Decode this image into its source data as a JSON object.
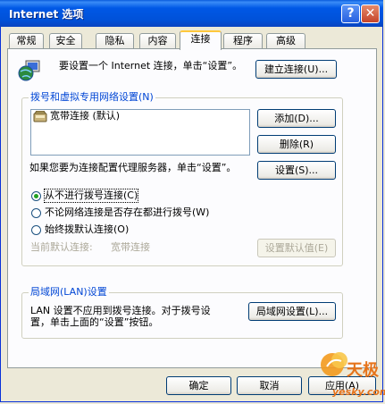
{
  "window": {
    "title": "Internet 选项",
    "help": "?",
    "close": "✕"
  },
  "tabs": [
    "常规",
    "安全",
    "隐私",
    "内容",
    "连接",
    "程序",
    "高级"
  ],
  "setup": {
    "text": "要设置一个 Internet 连接，单击“设置”。",
    "button": "建立连接(U)..."
  },
  "dialup": {
    "legend": "拨号和虚拟专用网络设置(N)",
    "entries": [
      "宽带连接 (默认)"
    ],
    "add": "添加(D)...",
    "remove": "删除(R)",
    "settings_text": "如果您要为连接配置代理服务器，单击“设置”。",
    "settings": "设置(S)...",
    "options": [
      "从不进行拨号连接(C)",
      "不论网络连接是否存在都进行拨号(W)",
      "始终拨默认连接(O)"
    ],
    "selected": 0,
    "current_label": "当前默认连接:",
    "current_value": "宽带连接",
    "set_default": "设置默认值(E)"
  },
  "lan": {
    "legend": "局域网(LAN)设置",
    "text_lines": [
      "LAN 设置不应用到拨号连接。对于拨号设",
      "置，单击上面的“设置”按钮。"
    ],
    "button": "局域网设置(L)..."
  },
  "footer": {
    "ok": "确定",
    "cancel": "取消",
    "apply": "应用(A)"
  },
  "watermark": {
    "brand": "天极",
    "domain": "yesky.com"
  },
  "colors": {
    "titlebar": "#0058e6",
    "face": "#ece9d8",
    "panel": "#fcfcfe",
    "legend": "#0046d5"
  }
}
